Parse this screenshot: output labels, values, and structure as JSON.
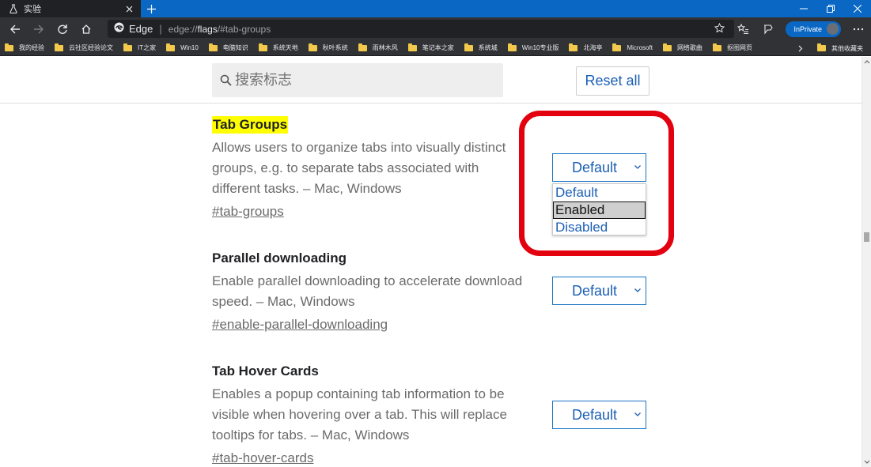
{
  "tab": {
    "title": "实验",
    "icon": "flask-icon"
  },
  "window_controls": {
    "minimize": "minimize-icon",
    "restore": "restore-icon",
    "close": "close-icon"
  },
  "toolbar": {
    "brand": "Edge",
    "url_prefix": "edge://",
    "url_bold": "flags",
    "url_suffix": "/#tab-groups",
    "inprivate": "InPrivate"
  },
  "bookmarks": [
    "我的经验",
    "云社区经验论文",
    "IT之家",
    "Win10",
    "电脑知识",
    "系统天地",
    "秋叶系统",
    "雨林木风",
    "笔记本之家",
    "系统城",
    "Win10专业版",
    "北海亭",
    "Microsoft",
    "网络歌曲",
    "抠图网页"
  ],
  "bookmarks_other": "其他收藏夹",
  "search": {
    "placeholder": "搜索标志"
  },
  "reset_label": "Reset all",
  "flags": [
    {
      "title": "Tab Groups",
      "desc": "Allows users to organize tabs into visually distinct groups, e.g. to separate tabs associated with different tasks. – Mac, Windows",
      "link": "#tab-groups",
      "value": "Default"
    },
    {
      "title": "Parallel downloading",
      "desc": "Enable parallel downloading to accelerate download speed. – Mac, Windows",
      "link": "#enable-parallel-downloading",
      "value": "Default"
    },
    {
      "title": "Tab Hover Cards",
      "desc": "Enables a popup containing tab information to be visible when hovering over a tab. This will replace tooltips for tabs. – Mac, Windows",
      "link": "#tab-hover-cards",
      "value": "Default"
    }
  ],
  "dropdown_options": [
    "Default",
    "Enabled",
    "Disabled"
  ],
  "dropdown_selected": "Enabled",
  "colors": {
    "accent": "#1a5fb4",
    "titlebar": "#0a68c4",
    "highlight": "#ffff00",
    "annotation": "#e3000f"
  }
}
